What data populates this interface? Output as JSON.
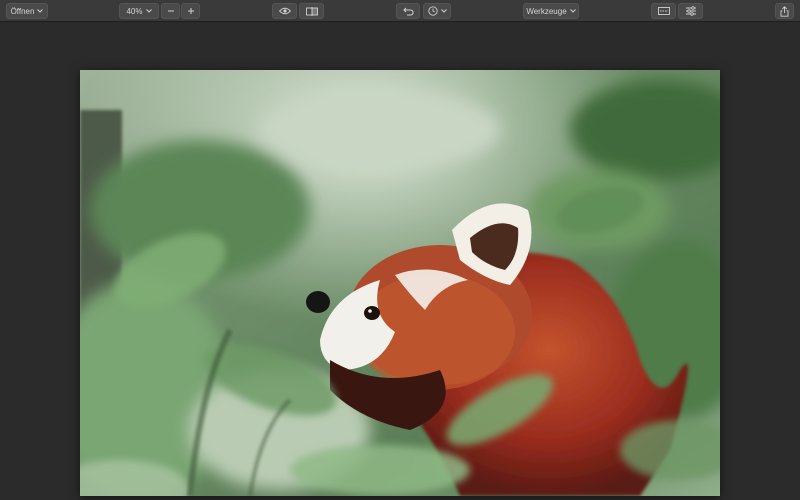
{
  "toolbar": {
    "open_label": "Öffnen",
    "zoom_value": "40%",
    "tools_label": "Werkzeuge",
    "icons": {
      "open_chevron": "chevron-down-icon",
      "zoom_chevron": "chevron-down-icon",
      "zoom_out": "minus-icon",
      "zoom_in": "plus-icon",
      "preview": "eye-icon",
      "compare": "split-view-icon",
      "undo": "undo-icon",
      "history": "clock-icon",
      "tools_chevron": "chevron-down-icon",
      "panels": "panels-icon",
      "adjustments": "sliders-icon",
      "share": "share-icon"
    }
  },
  "canvas": {
    "image_subject": "red panda among green leaves",
    "colors": {
      "background": "#2b2b2b",
      "toolbar": "#3a3a3a",
      "button": "#4a4a4a"
    }
  }
}
